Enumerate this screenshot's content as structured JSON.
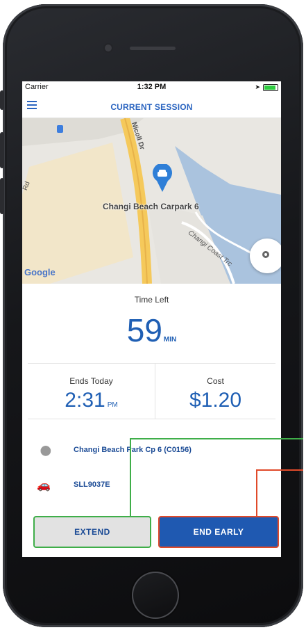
{
  "status_bar": {
    "carrier": "Carrier",
    "time": "1:32 PM"
  },
  "nav": {
    "title": "CURRENT SESSION",
    "menu_icon": "hamburger-menu-icon"
  },
  "map": {
    "place_label": "Changi Beach Carpark 6",
    "road_labels": [
      "Nicoll Dr",
      "Changi Coast Trc",
      "Rd"
    ],
    "attribution": "Google",
    "pin_icon": "car-pin-icon",
    "locate_icon": "locate-me-icon"
  },
  "time_left": {
    "label": "Time Left",
    "value": "59",
    "unit": "MIN"
  },
  "ends": {
    "label": "Ends Today",
    "value": "2:31",
    "suffix": "PM"
  },
  "cost": {
    "label": "Cost",
    "value": "$1.20"
  },
  "location": {
    "icon": "location-pin-icon",
    "text": "Changi Beach Park Cp 6 (C0156)"
  },
  "vehicle": {
    "icon": "car-icon",
    "text": "SLL9037E"
  },
  "buttons": {
    "extend": "EXTEND",
    "end_early": "END EARLY"
  },
  "colors": {
    "accent": "#1f59b1",
    "title_blue": "#2a64c0",
    "extend_highlight": "#3fae49",
    "end_highlight": "#e04a2a"
  }
}
